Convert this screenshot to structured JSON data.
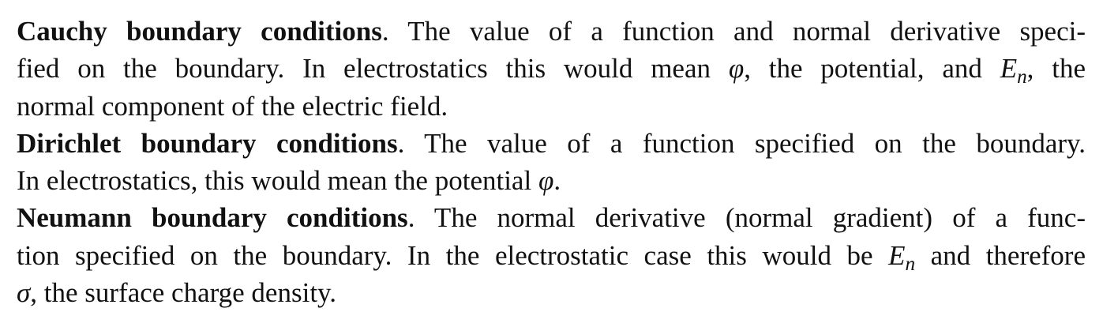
{
  "document": {
    "paragraphs": [
      {
        "term": "Cauchy boundary conditions",
        "lines": [
          {
            "after_term": ". The value of a function and normal derivative speci-"
          },
          {
            "a": "fied on the boundary. In electrostatics this would mean ",
            "phi": "φ",
            "b": ", the potential, and ",
            "E": "E",
            "n": "n",
            "c": ", the"
          },
          {
            "text": "normal component of the electric field."
          }
        ]
      },
      {
        "term": "Dirichlet boundary conditions",
        "lines": [
          {
            "after_term": ". The value of a function specified on the boundary."
          },
          {
            "a": "In electrostatics, this would mean the potential ",
            "phi": "φ",
            "b": "."
          }
        ]
      },
      {
        "term": "Neumann boundary conditions",
        "lines": [
          {
            "after_term": ". The normal derivative (normal gradient) of a func-"
          },
          {
            "a": "tion specified on the boundary. In the electrostatic case this would be ",
            "E": "E",
            "n": "n",
            "b": " and therefore"
          },
          {
            "sigma": "σ",
            "a": ", the surface charge density."
          }
        ]
      }
    ]
  }
}
